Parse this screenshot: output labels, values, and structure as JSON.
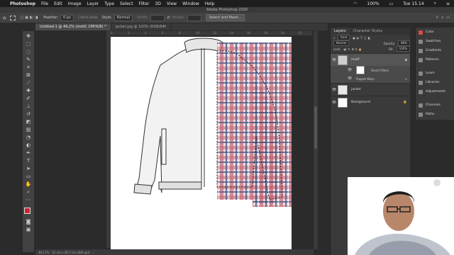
{
  "menubar": {
    "apple": "",
    "app_name": "Photoshop",
    "items": [
      "File",
      "Edit",
      "Image",
      "Layer",
      "Type",
      "Select",
      "Filter",
      "3D",
      "View",
      "Window",
      "Help"
    ],
    "battery": "100%",
    "clock": "Tue 15.14"
  },
  "window_title": "Adobe Photoshop 2020",
  "options_bar": {
    "feather_label": "Feather:",
    "feather_value": "0 px",
    "antialias_label": "Anti-alias",
    "style_label": "Style:",
    "style_value": "Normal",
    "width_label": "Width:",
    "height_label": "Height:",
    "select_mask_label": "Select and Mask..."
  },
  "document_tabs": [
    {
      "label": "Untitled-1 @ 49,2% (motif, CMYK/8) *",
      "active": true
    },
    {
      "label": "jacket.jpg @ 100% (RGB/8#)",
      "active": false
    }
  ],
  "ruler_ticks": [
    "0",
    "2",
    "4",
    "6",
    "8",
    "10",
    "12",
    "14",
    "16",
    "18",
    "20",
    "22"
  ],
  "status_bar": {
    "zoom": "49,17%",
    "doc_size": "21 cm x 29,7 cm (300 ppi)"
  },
  "layers_panel": {
    "tabs": [
      "Layers",
      "Character Styles"
    ],
    "kind_label": "Kind",
    "blend_mode": "Normal",
    "opacity_label": "Opacity:",
    "opacity_value": "88%",
    "lock_label": "Lock:",
    "fill_label": "Fill:",
    "fill_value": "100%",
    "layers": [
      {
        "name": "motif",
        "active": true
      },
      {
        "name": "jacket",
        "active": false
      },
      {
        "name": "Background",
        "active": false
      }
    ],
    "smart_filters_label": "Smart Filters",
    "puppet_warp_label": "Puppet Warp"
  },
  "right_dock": {
    "group1": [
      "Color",
      "Swatches",
      "Gradients",
      "Patterns"
    ],
    "group2": [
      "Learn",
      "Libraries",
      "Adjustments"
    ],
    "group3": [
      "Channels",
      "Paths"
    ]
  },
  "colors": {
    "foreground": "#cc2233",
    "background": "#111111",
    "plaid_red": "#c05a6a",
    "plaid_navy": "#3c4a78"
  }
}
